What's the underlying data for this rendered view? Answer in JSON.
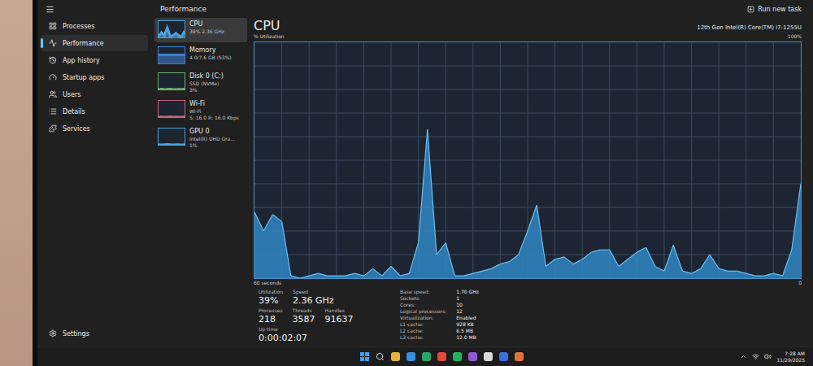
{
  "header": {
    "title": "Performance",
    "action": "Run new task"
  },
  "sidebar": {
    "items": [
      {
        "label": "Processes",
        "selected": false
      },
      {
        "label": "Performance",
        "selected": true
      },
      {
        "label": "App history",
        "selected": false
      },
      {
        "label": "Startup apps",
        "selected": false
      },
      {
        "label": "Users",
        "selected": false
      },
      {
        "label": "Details",
        "selected": false
      },
      {
        "label": "Services",
        "selected": false
      }
    ],
    "footer": {
      "label": "Settings"
    }
  },
  "devices": [
    {
      "name": "CPU",
      "details": [
        "39% 2.36 GHz"
      ],
      "selected": true,
      "color": "#4aa3df",
      "values": [
        5,
        30,
        10,
        60,
        8,
        12,
        25,
        10,
        5,
        40
      ]
    },
    {
      "name": "Memory",
      "details": [
        "4.0/7.6 GB (53%)"
      ],
      "selected": false,
      "color": "#3f7fd0",
      "values": [
        53,
        53,
        53,
        53,
        53,
        53,
        53,
        53,
        53,
        53
      ]
    },
    {
      "name": "Disk 0 (C:)",
      "details": [
        "SSD (NVMe)",
        "3%"
      ],
      "selected": false,
      "color": "#6cb36c",
      "values": [
        0,
        2,
        0,
        1,
        3,
        0,
        0,
        1,
        0,
        3
      ]
    },
    {
      "name": "Wi-Fi",
      "details": [
        "Wi-Fi",
        "S: 16.0 R: 16.0 Kbps"
      ],
      "selected": false,
      "color": "#c8667f",
      "values": [
        0,
        1,
        0,
        0,
        2,
        0,
        1,
        0,
        0,
        1
      ]
    },
    {
      "name": "GPU 0",
      "details": [
        "Intel(R) UHD Gra...",
        "1%"
      ],
      "selected": false,
      "color": "#4aa3df",
      "values": [
        1,
        0,
        1,
        2,
        1,
        0,
        1,
        1,
        0,
        1
      ]
    }
  ],
  "cpu": {
    "title": "CPU",
    "model": "12th Gen Intel(R) Core(TM) i7-1255U",
    "y_label": "% Utilization",
    "y_max": "100%",
    "x_label": "60 seconds",
    "y_min": "0",
    "series": [
      28,
      20,
      27,
      24,
      1,
      0,
      1,
      2,
      1,
      1,
      1,
      2,
      1,
      4,
      1,
      5,
      1,
      2,
      15,
      63,
      10,
      15,
      1,
      1,
      2,
      3,
      4,
      6,
      7,
      10,
      20,
      31,
      5,
      8,
      9,
      6,
      8,
      11,
      12,
      12,
      5,
      8,
      11,
      13,
      5,
      3,
      14,
      3,
      2,
      4,
      10,
      4,
      3,
      3,
      2,
      1,
      1,
      2,
      1,
      12,
      40
    ]
  },
  "stats": {
    "rows": [
      [
        {
          "label": "Utilization",
          "value": "39%"
        },
        {
          "label": "Speed",
          "value": "2.36 GHz"
        }
      ],
      [
        {
          "label": "Processes",
          "value": "218"
        },
        {
          "label": "Threads",
          "value": "3587"
        },
        {
          "label": "Handles",
          "value": "91637"
        }
      ],
      [
        {
          "label": "Up time",
          "value": "0:00:02:07"
        }
      ]
    ],
    "specs": [
      {
        "label": "Base speed:",
        "value": "1.70 GHz"
      },
      {
        "label": "Sockets:",
        "value": "1"
      },
      {
        "label": "Cores:",
        "value": "10"
      },
      {
        "label": "Logical processors:",
        "value": "12"
      },
      {
        "label": "Virtualization:",
        "value": "Enabled"
      },
      {
        "label": "L1 cache:",
        "value": "928 KB"
      },
      {
        "label": "L2 cache:",
        "value": "6.5 MB"
      },
      {
        "label": "L3 cache:",
        "value": "12.0 MB"
      }
    ]
  },
  "taskbar": {
    "time": "7:28 AM",
    "date": "11/29/2025"
  }
}
